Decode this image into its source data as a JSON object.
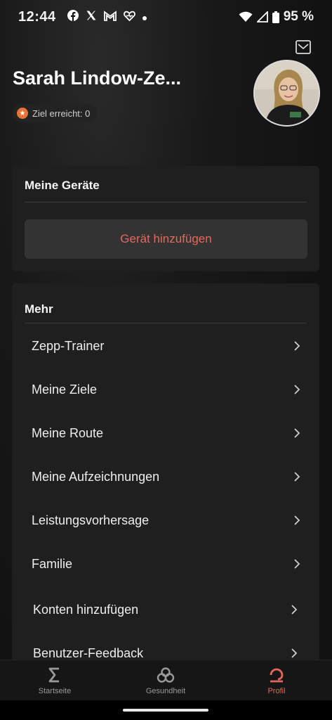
{
  "status_bar": {
    "time": "12:44",
    "notifications": [
      "facebook-icon",
      "x-icon",
      "gmail-icon",
      "health-heart-icon",
      "dot"
    ],
    "battery": "95 %"
  },
  "profile": {
    "name": "Sarah Lindow-Ze...",
    "goal_badge": "Ziel erreicht: 0"
  },
  "devices": {
    "title": "Meine Geräte",
    "add_button": "Gerät hinzufügen"
  },
  "more": {
    "title": "Mehr",
    "items": [
      {
        "label": "Zepp-Trainer"
      },
      {
        "label": "Meine Ziele"
      },
      {
        "label": "Meine Route"
      },
      {
        "label": "Meine Aufzeichnungen"
      },
      {
        "label": "Leistungsvorhersage"
      },
      {
        "label": "Familie"
      },
      {
        "label": "Konten hinzufügen"
      },
      {
        "label": "Benutzer-Feedback"
      }
    ]
  },
  "bottom_nav": {
    "items": [
      {
        "label": "Startseite",
        "icon": "sigma-icon"
      },
      {
        "label": "Gesundheit",
        "icon": "health-icon"
      },
      {
        "label": "Profil",
        "icon": "profile-icon"
      }
    ],
    "active": "Profil"
  },
  "colors": {
    "accent": "#e5685c",
    "card": "#1f1f1f",
    "badge_icon": "#e8743a"
  }
}
